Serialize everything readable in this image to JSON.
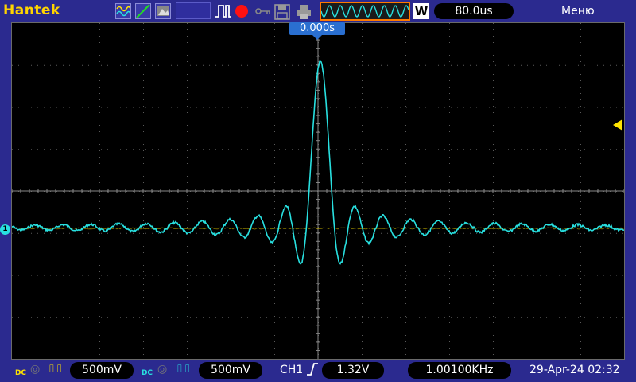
{
  "header": {
    "brand": "Hantek",
    "timebase": "80.0us",
    "w_label": "W",
    "menu": "Меню",
    "trigger_position": "0.000s"
  },
  "footer": {
    "ch1_volts_div": "500mV",
    "ch2_volts_div": "500mV",
    "trigger_source": "CH1",
    "trigger_level": "1.32V",
    "frequency": "1.00100KHz",
    "datetime": "29-Apr-24 02:32",
    "ch1_coupling": "DC",
    "ch2_coupling": "DC",
    "channel_marker": "1"
  },
  "colors": {
    "ch1": "#ffe400",
    "ch2": "#28e0e0",
    "trace": "#28e0e0",
    "grid": "#5a5a5a",
    "background": "#000000",
    "bar": "#2b2a8f"
  },
  "icons": [
    "wave-icon",
    "rising-edge-icon",
    "image-icon",
    "pulse-icon",
    "record-icon",
    "key-icon",
    "save-icon",
    "print-icon"
  ]
}
